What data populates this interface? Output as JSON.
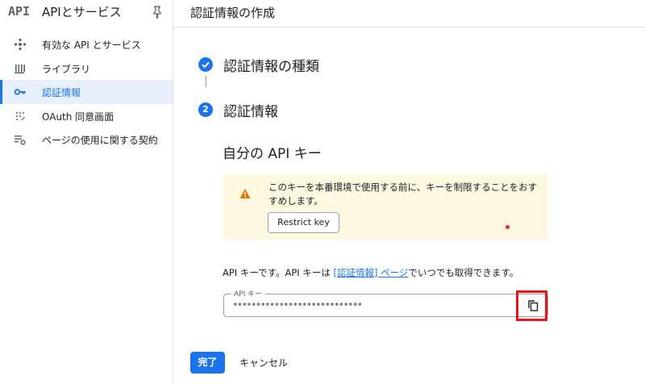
{
  "sidebar": {
    "logo": "API",
    "title": "APIとサービス",
    "items": [
      {
        "label": "有効な API とサービス",
        "icon": "api-diamond-icon",
        "active": false
      },
      {
        "label": "ライブラリ",
        "icon": "library-icon",
        "active": false
      },
      {
        "label": "認証情報",
        "icon": "key-icon",
        "active": true
      },
      {
        "label": "OAuth 同意画面",
        "icon": "oauth-consent-icon",
        "active": false
      },
      {
        "label": "ページの使用に関する契約",
        "icon": "agreement-settings-icon",
        "active": false
      }
    ]
  },
  "header": {
    "title": "認証情報の作成"
  },
  "stepper": {
    "steps": [
      {
        "label": "認証情報の種類",
        "state": "done"
      },
      {
        "number": "2",
        "label": "認証情報",
        "state": "current"
      }
    ]
  },
  "section": {
    "title": "自分の API キー"
  },
  "warning": {
    "text": "このキーを本番環境で使用する前に、キーを制限することをおすすめします。",
    "button_label": "Restrict key"
  },
  "info": {
    "before": "API キーです。API キーは ",
    "link": "[認証情報] ページ",
    "after": "でいつでも取得できます。"
  },
  "api_key": {
    "label": "API キー",
    "value": "****************************"
  },
  "footer": {
    "done_label": "完了",
    "cancel_label": "キャンセル"
  },
  "colors": {
    "accent": "#1a73e8",
    "warning_bg": "#fef7e0",
    "warning_icon": "#e37400",
    "highlight": "#e8161b"
  }
}
